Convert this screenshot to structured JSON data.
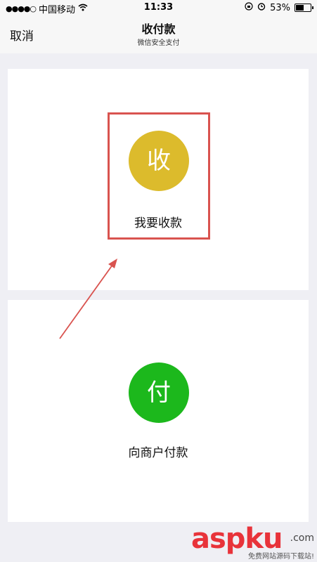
{
  "status_bar": {
    "signal": "●●●●○",
    "carrier": "中国移动",
    "wifi_icon": "wifi-icon",
    "time": "11:33",
    "battery_percent": "53%",
    "battery_level": 0.53
  },
  "nav": {
    "cancel_label": "取消",
    "title": "收付款",
    "subtitle": "微信安全支付"
  },
  "receive": {
    "icon_char": "收",
    "label": "我要收款",
    "color": "#dcbb2c"
  },
  "pay": {
    "icon_char": "付",
    "label": "向商户付款",
    "color": "#1cb81c"
  },
  "annotation": {
    "highlight_color": "#d9534f"
  },
  "watermark": {
    "main": "aspku",
    "tld": ".com",
    "sub": "免费网站源码下载站!"
  }
}
